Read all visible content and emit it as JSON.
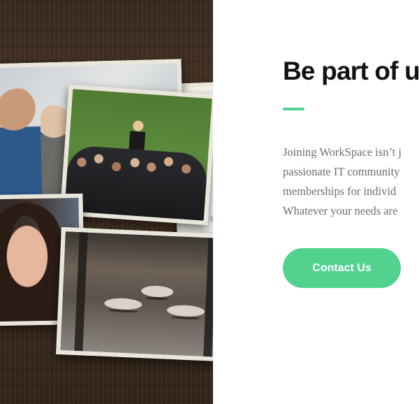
{
  "hero": {
    "title": "Be part of us",
    "body_lines": [
      "Joining WorkSpace isn’t j",
      "passionate IT community",
      "memberships for individ",
      "Whatever your needs are"
    ],
    "cta_label": "Contact Us"
  },
  "colors": {
    "accent": "#52d28f",
    "title_text": "#111111",
    "body_text": "#6e6e6e",
    "background": "#ffffff"
  },
  "collage": {
    "photos": [
      "two-men-photo",
      "crowd-on-grass-photo",
      "smiling-woman-photo",
      "industrial-room-photo",
      "partial-edge-photo"
    ]
  }
}
